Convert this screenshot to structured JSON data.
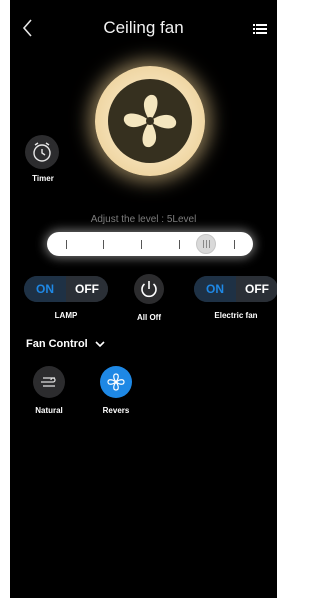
{
  "header": {
    "title": "Ceiling fan",
    "back_icon": "chevron-left-icon",
    "menu_icon": "list-icon"
  },
  "fan": {
    "icon": "fan-icon",
    "glow_color": "#f3d496",
    "blade_color": "#f4e6bf"
  },
  "timer": {
    "label": "Timer",
    "icon": "clock-icon"
  },
  "level": {
    "text": "Adjust the level : 5Level",
    "value": 5
  },
  "lamp": {
    "on_label": "ON",
    "off_label": "OFF",
    "label": "LAMP"
  },
  "all_off": {
    "label": "All Off",
    "icon": "power-icon"
  },
  "electric_fan": {
    "on_label": "ON",
    "off_label": "OFF",
    "label": "Electric fan"
  },
  "fan_control": {
    "label": "Fan Control",
    "modes": [
      {
        "label": "Natural",
        "icon": "wind-icon",
        "active": false
      },
      {
        "label": "Revers",
        "icon": "fan-icon",
        "active": true
      }
    ]
  },
  "colors": {
    "accent": "#1e88e5",
    "background": "#000000"
  }
}
